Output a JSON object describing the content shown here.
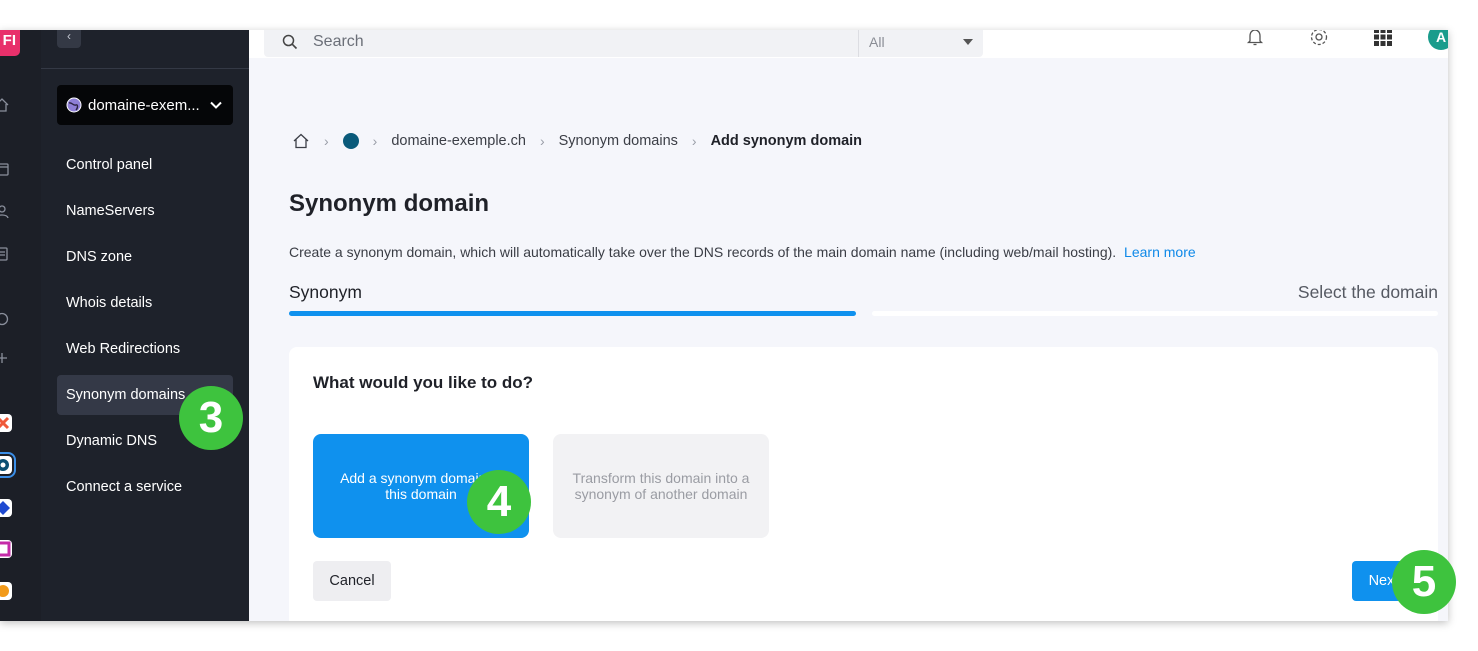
{
  "rail": {
    "logo_letter": "FI",
    "icons": [
      "home-icon",
      "calendar-icon",
      "users-icon",
      "document-icon",
      "support-icon",
      "settings-icon"
    ],
    "apps": [
      {
        "name": "kmail-app-icon",
        "color": "#ef5a3a"
      },
      {
        "name": "kdrive-app-icon",
        "color": "#0a4f73"
      },
      {
        "name": "kchat-app-icon",
        "color": "#1f4ad1"
      },
      {
        "name": "ksuite-app-icon",
        "color": "#c52aa8"
      },
      {
        "name": "kmeet-app-icon",
        "color": "#f29a1a"
      }
    ]
  },
  "sidebar": {
    "collapse_label": "‹",
    "domain": "domaine-exem...",
    "items": [
      {
        "label": "Control panel",
        "active": false
      },
      {
        "label": "NameServers",
        "active": false
      },
      {
        "label": "DNS zone",
        "active": false
      },
      {
        "label": "Whois details",
        "active": false
      },
      {
        "label": "Web Redirections",
        "active": false
      },
      {
        "label": "Synonym domains",
        "active": true
      },
      {
        "label": "Dynamic DNS",
        "active": false
      },
      {
        "label": "Connect a service",
        "active": false
      }
    ]
  },
  "topbar": {
    "search_placeholder": "Search",
    "search_scope": "All",
    "avatar_initial": "A"
  },
  "breadcrumb": {
    "domain": "domaine-exemple.ch",
    "section": "Synonym domains",
    "current": "Add synonym domain"
  },
  "page": {
    "title": "Synonym domain",
    "description": "Create a synonym domain, which will automatically take over the DNS records of the main domain name (including web/mail hosting).",
    "learn_more": "Learn more",
    "step1": "Synonym",
    "step2": "Select the domain",
    "progress_fraction": 0.5
  },
  "card": {
    "question": "What would you like to do?",
    "option_add": "Add a synonym domain to this domain",
    "option_transform": "Transform this domain into a synonym of another domain",
    "cancel": "Cancel",
    "next": "Next"
  },
  "callouts": {
    "sidebar_step": "3",
    "option_step": "4",
    "next_step": "5"
  },
  "colors": {
    "accent": "#0f91ee",
    "callout": "#3ec33e",
    "sidebar_bg": "#1e222b",
    "brand": "#e8306b"
  }
}
